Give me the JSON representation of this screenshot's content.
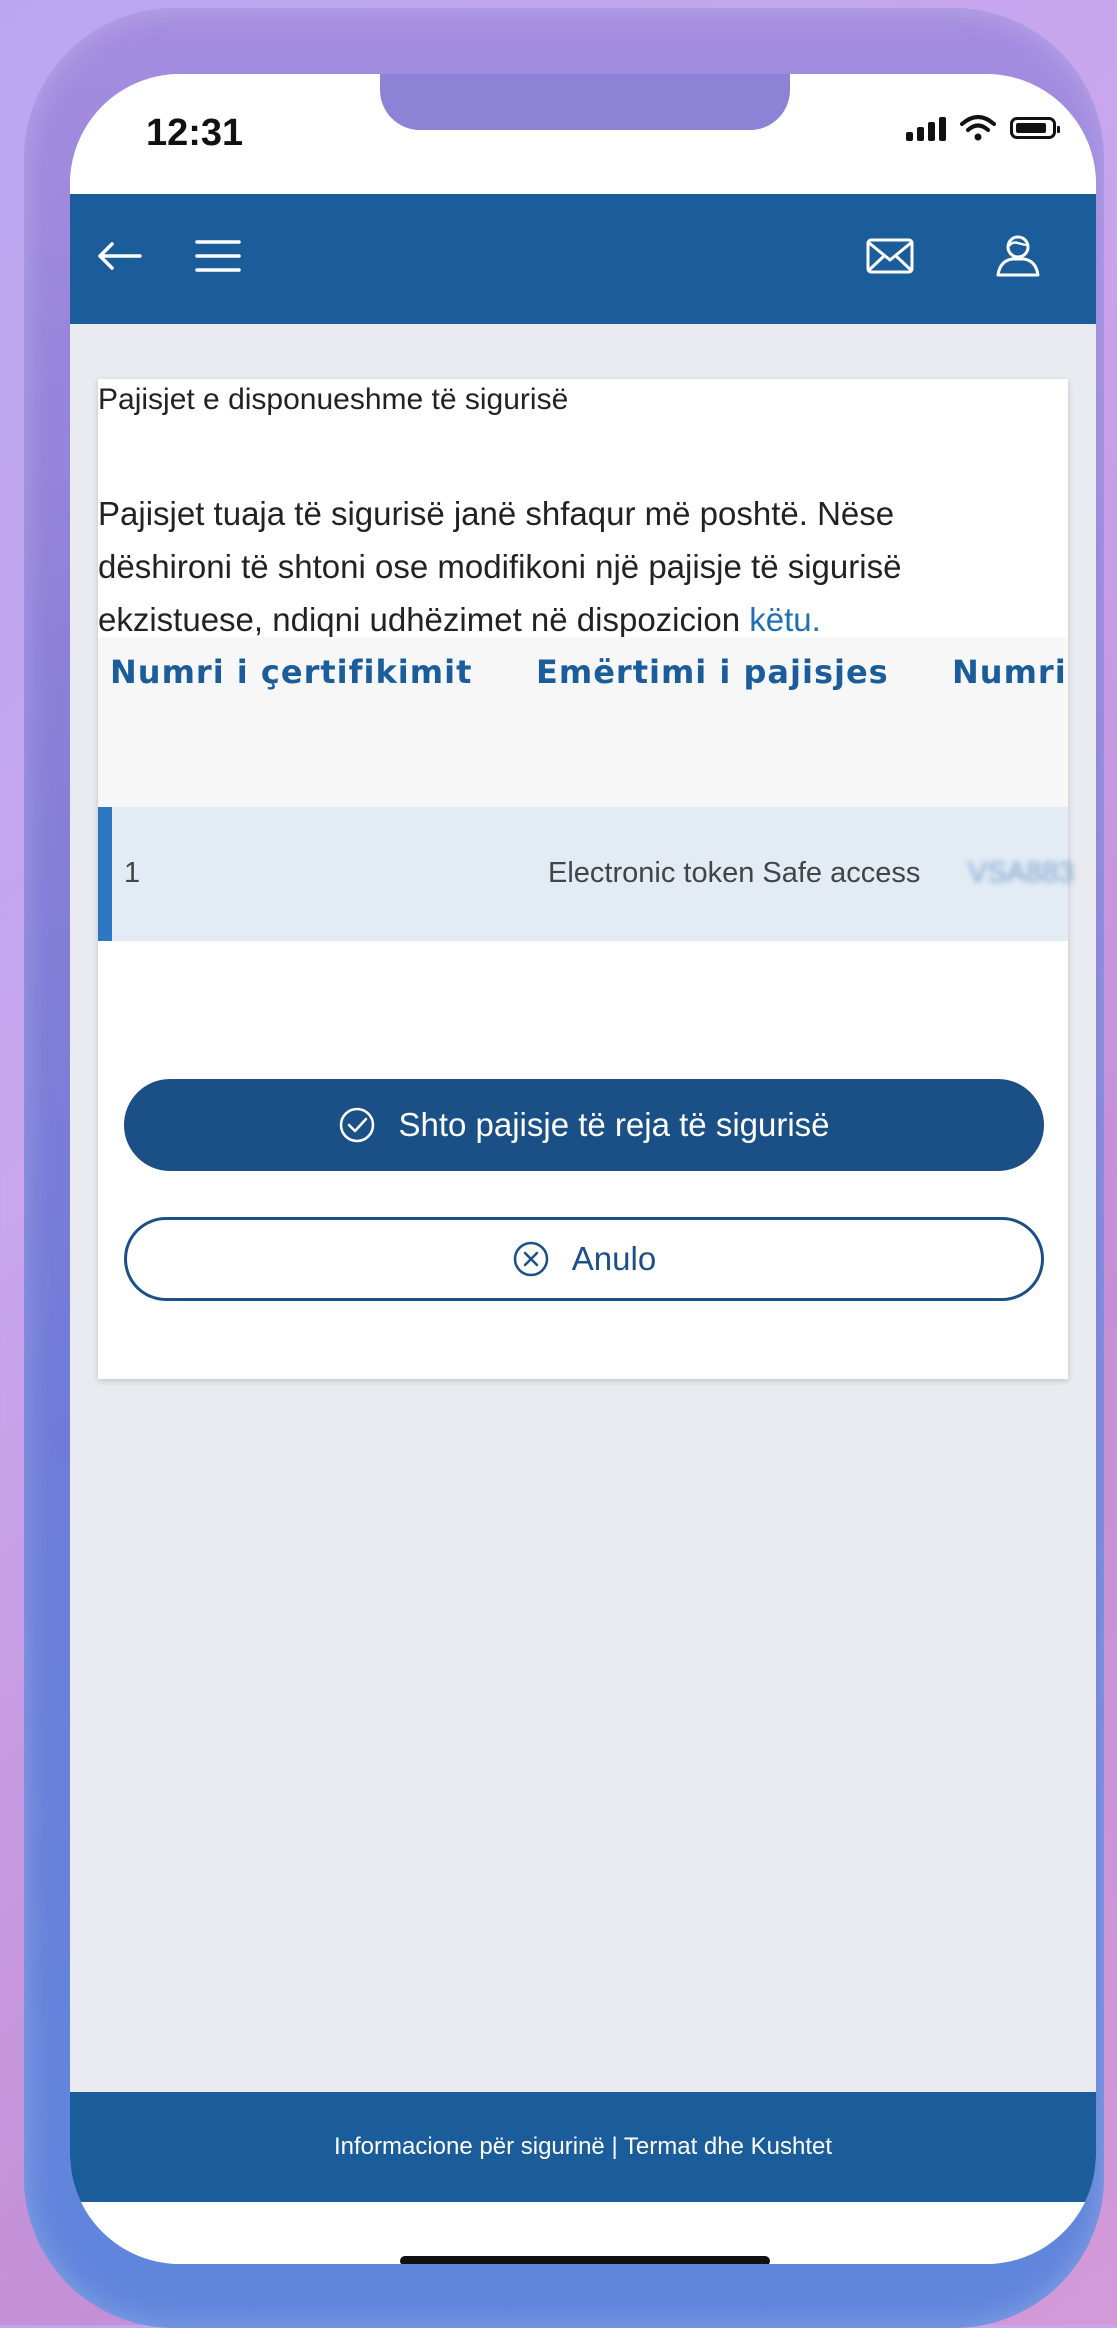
{
  "status_bar": {
    "time": "12:31"
  },
  "header": {
    "back_icon": "arrow-left-icon",
    "menu_icon": "hamburger-icon",
    "mail_icon": "envelope-icon",
    "user_icon": "user-icon"
  },
  "card": {
    "title": "Pajisjet e disponueshme të sigurisë",
    "description": "Pajisjet tuaja të sigurisë janë shfaqur më poshtë. Nëse dëshironi të shtoni ose modifikoni një pajisje të sigurisë ekzistuese, ndiqni udhëzimet në dispozicion ",
    "link": "këtu."
  },
  "table": {
    "columns": [
      "Numri i çertifikimit",
      "Emërtimi i pajisjes",
      "Numri"
    ],
    "rows": [
      {
        "number": "1",
        "device": "Electronic token Safe access",
        "serial": "VSA883"
      }
    ]
  },
  "buttons": {
    "add_label": "Shto pajisje të reja të sigurisë",
    "cancel_label": "Anulo"
  },
  "footer": {
    "text": "Informacione për sigurinë | Termat dhe Kushtet"
  },
  "colors": {
    "brand": "#1b5c9a",
    "accent": "#2e78c2",
    "link": "#1f6fb5"
  }
}
